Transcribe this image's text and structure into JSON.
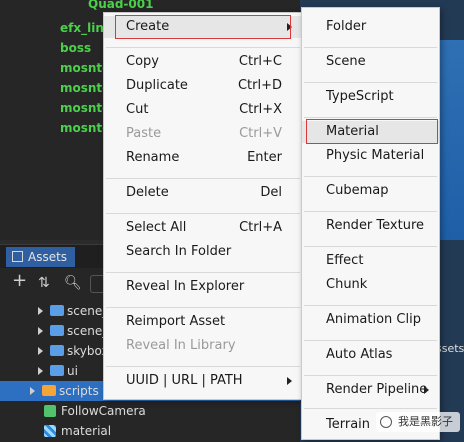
{
  "hierarchy": {
    "rows": [
      "Quad-001",
      "efx_line",
      "boss",
      "mosnter",
      "mosnter",
      "mosnter",
      "mosnter"
    ]
  },
  "assets_panel": {
    "tab_label": "Assets",
    "tree": [
      {
        "label": "scene_",
        "type": "folder"
      },
      {
        "label": "scene_",
        "type": "folder"
      },
      {
        "label": "skybox",
        "type": "folder"
      },
      {
        "label": "ui",
        "type": "folder"
      },
      {
        "label": "scripts",
        "type": "folder",
        "selected": true
      },
      {
        "label": "FollowCamera",
        "type": "script"
      },
      {
        "label": "material",
        "type": "material"
      }
    ]
  },
  "context_menu": {
    "items": [
      {
        "label": "Create",
        "shortcut": "",
        "has_submenu": true,
        "highlighted": true
      },
      {
        "label": "Copy",
        "shortcut": "Ctrl+C"
      },
      {
        "label": "Duplicate",
        "shortcut": "Ctrl+D"
      },
      {
        "label": "Cut",
        "shortcut": "Ctrl+X"
      },
      {
        "label": "Paste",
        "shortcut": "Ctrl+V",
        "disabled": true
      },
      {
        "label": "Rename",
        "shortcut": "Enter"
      },
      {
        "label": "Delete",
        "shortcut": "Del"
      },
      {
        "label": "Select All",
        "shortcut": "Ctrl+A"
      },
      {
        "label": "Search In Folder",
        "shortcut": ""
      },
      {
        "label": "Reveal In Explorer",
        "shortcut": ""
      },
      {
        "label": "Reimport Asset",
        "shortcut": ""
      },
      {
        "label": "Reveal In Library",
        "shortcut": "",
        "disabled": true
      },
      {
        "label": "UUID | URL | PATH",
        "shortcut": "",
        "has_submenu": true
      }
    ]
  },
  "create_submenu": {
    "items": [
      {
        "label": "Folder"
      },
      {
        "label": "Scene"
      },
      {
        "label": "TypeScript"
      },
      {
        "label": "Material",
        "highlighted": true
      },
      {
        "label": "Physic Material"
      },
      {
        "label": "Cubemap"
      },
      {
        "label": "Render Texture"
      },
      {
        "label": "Effect"
      },
      {
        "label": "Chunk"
      },
      {
        "label": "Animation Clip"
      },
      {
        "label": "Auto Atlas"
      },
      {
        "label": "Render Pipeline",
        "has_submenu": true
      },
      {
        "label": "Terrain"
      }
    ]
  },
  "side_panel": {
    "tab_label": "ssets"
  },
  "watermark": {
    "text": "我是黑影子"
  },
  "colors": {
    "accent": "#2d6fc0",
    "highlight_box": "#d9393a",
    "tree_green": "#4cd04c"
  }
}
